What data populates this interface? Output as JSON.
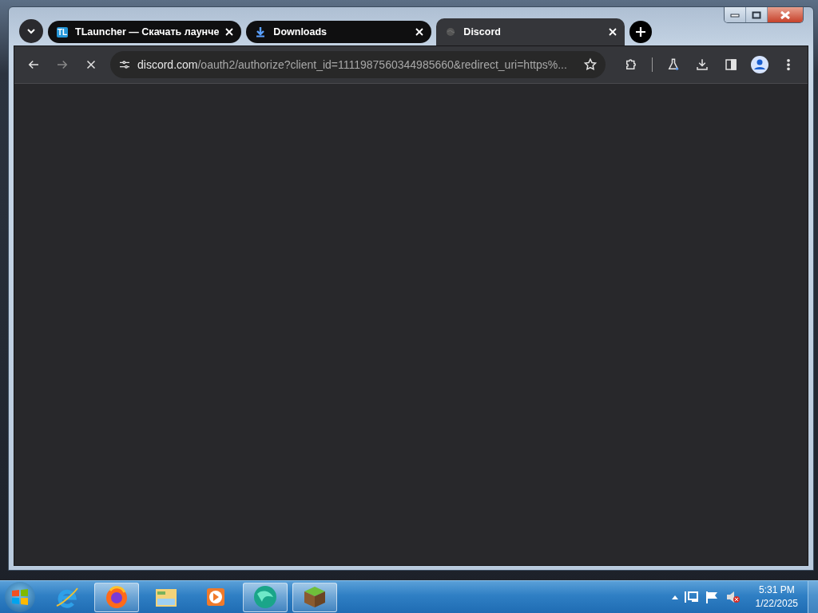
{
  "tabs": [
    {
      "title": "TLauncher — Скачать лаунче",
      "icon_text": "TL",
      "selected": false
    },
    {
      "title": "Downloads",
      "selected": false
    },
    {
      "title": "Discord",
      "selected": true
    }
  ],
  "toolbar": {
    "loading": true,
    "url_host": "discord.com",
    "url_path": "/oauth2/authorize?client_id=1111987560344985660&redirect_uri=https%..."
  },
  "taskbar": {
    "apps": [
      {
        "running": false
      },
      {
        "running": true
      },
      {
        "running": false
      },
      {
        "running": false
      },
      {
        "running": true
      },
      {
        "running": true
      }
    ],
    "tray": {
      "muted": true,
      "time": "5:31 PM",
      "date": "1/22/2025"
    }
  }
}
